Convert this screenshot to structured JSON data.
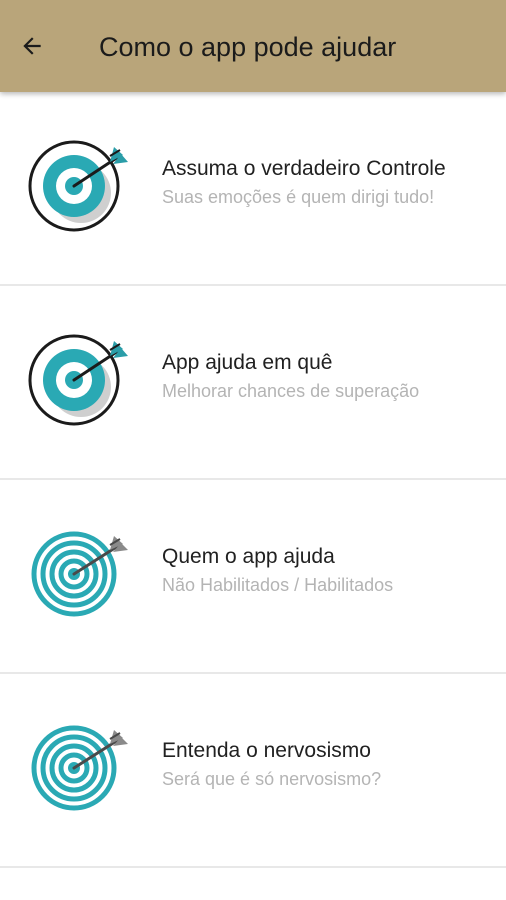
{
  "app_bar": {
    "back_icon": "arrow-left-icon",
    "title": "Como o app pode ajudar",
    "color": "#b9a57a"
  },
  "items": [
    {
      "title": "Assuma o verdadeiro Controle",
      "subtitle": "Suas emoções é quem dirigi tudo!",
      "icon": "target-dart-icon"
    },
    {
      "title": "App ajuda em quê",
      "subtitle": "Melhorar chances de superação",
      "icon": "target-dart-icon"
    },
    {
      "title": "Quem o app ajuda",
      "subtitle": "Não Habilitados / Habilitados",
      "icon": "target-rings-dart-icon"
    },
    {
      "title": "Entenda o nervosismo",
      "subtitle": "Será que é só nervosismo?",
      "icon": "target-rings-dart-icon"
    }
  ],
  "colors": {
    "teal": "#2aa9b4",
    "dart_teal": "#2a9da8",
    "dart_gray": "#8a8a8a"
  }
}
